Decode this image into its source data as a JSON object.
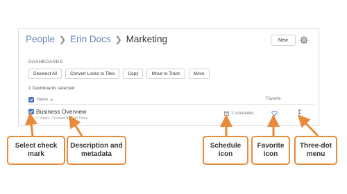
{
  "breadcrumb": {
    "items": [
      "People",
      "Erin Docs"
    ],
    "current": "Marketing"
  },
  "header": {
    "new_label": "New"
  },
  "section_label": "DASHBOARDS",
  "actions": [
    "Deselect All",
    "Convert Looks to Tiles",
    "Copy",
    "Move to Trash",
    "Move"
  ],
  "selected_count": "1 Dashboards selected",
  "columns": {
    "name": "Name",
    "favorite": "Favorite"
  },
  "row": {
    "title": "Business Overview",
    "meta": "2 Views, Created by Erin Docs",
    "scheduled": "1 scheduled"
  },
  "callouts": {
    "select": "Select check mark",
    "description": "Description and metadata",
    "schedule": "Schedule icon",
    "favorite": "Favorite icon",
    "menu": "Three-dot menu"
  },
  "colors": {
    "accent": "#4a78c2",
    "link": "#6283b6",
    "callout_border": "#e88a3a"
  }
}
